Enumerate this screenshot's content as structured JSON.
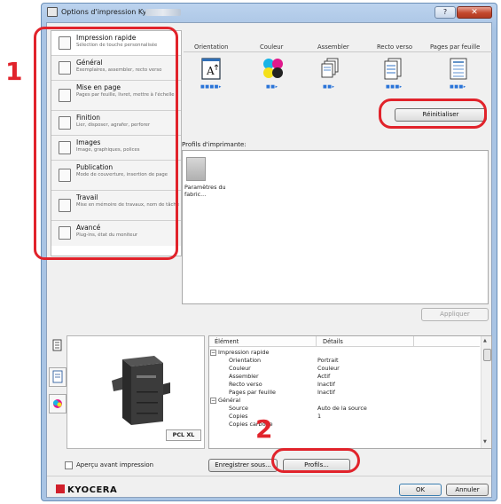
{
  "window": {
    "title": "Options d'impression Kyocera",
    "help_label": "?",
    "close_label": "✕"
  },
  "nav": {
    "items": [
      {
        "title": "Impression rapide",
        "subtitle": "Sélection de touche personnalisée"
      },
      {
        "title": "Général",
        "subtitle": "Exemplaires, assembler, recto verso"
      },
      {
        "title": "Mise en page",
        "subtitle": "Pages par feuille, livret, mettre à l'échelle"
      },
      {
        "title": "Finition",
        "subtitle": "Lier, disposer, agrafer, perforer"
      },
      {
        "title": "Images",
        "subtitle": "Image, graphiques, polices"
      },
      {
        "title": "Publication",
        "subtitle": "Mode de couverture, insertion de page"
      },
      {
        "title": "Travail",
        "subtitle": "Mise en mémoire de travaux, nom de tâche"
      },
      {
        "title": "Avancé",
        "subtitle": "Plug-ins, état du moniteur"
      }
    ]
  },
  "tabs": [
    "Orientation",
    "Couleur",
    "Assembler",
    "Recto verso",
    "Pages par feuille"
  ],
  "icons": {
    "orientation": "portrait-page-icon",
    "color": "cmyk-color-icon",
    "collate": "collate-pages-icon",
    "duplex": "duplex-icon",
    "pages_per_sheet": "pages-per-sheet-icon"
  },
  "reset_label": "Réinitialiser",
  "profiles": {
    "label": "Profils d'imprimante:",
    "items": [
      {
        "name": "Paramètres du fabric..."
      }
    ]
  },
  "apply_label": "Appliquer",
  "pcl_label": "PCL XL",
  "table": {
    "headers": [
      "Élément",
      "Détails"
    ],
    "rows": [
      {
        "item": "Impression rapide",
        "detail": "",
        "group": true
      },
      {
        "item": "Orientation",
        "detail": "Portrait",
        "group": false
      },
      {
        "item": "Couleur",
        "detail": "Couleur",
        "group": false
      },
      {
        "item": "Assembler",
        "detail": "Actif",
        "group": false
      },
      {
        "item": "Recto verso",
        "detail": "Inactif",
        "group": false
      },
      {
        "item": "Pages par feuille",
        "detail": "Inactif",
        "group": false
      },
      {
        "item": "Général",
        "detail": "",
        "group": true
      },
      {
        "item": "Source",
        "detail": "Auto de la source",
        "group": false
      },
      {
        "item": "Copies",
        "detail": "1",
        "group": false
      },
      {
        "item": "Copies carbone",
        "detail": "",
        "group": false
      }
    ]
  },
  "preview_label": "Aperçu avant impression",
  "save_as_label": "Enregistrer sous...",
  "profiles_button_label": "Profils...",
  "ok_label": "OK",
  "cancel_label": "Annuler",
  "brand": "KYOCERA",
  "callouts": [
    "1",
    "2"
  ],
  "colors": {
    "annotation": "#e1232b",
    "brand": "#d11f2b",
    "selection": "#2a74d8"
  }
}
